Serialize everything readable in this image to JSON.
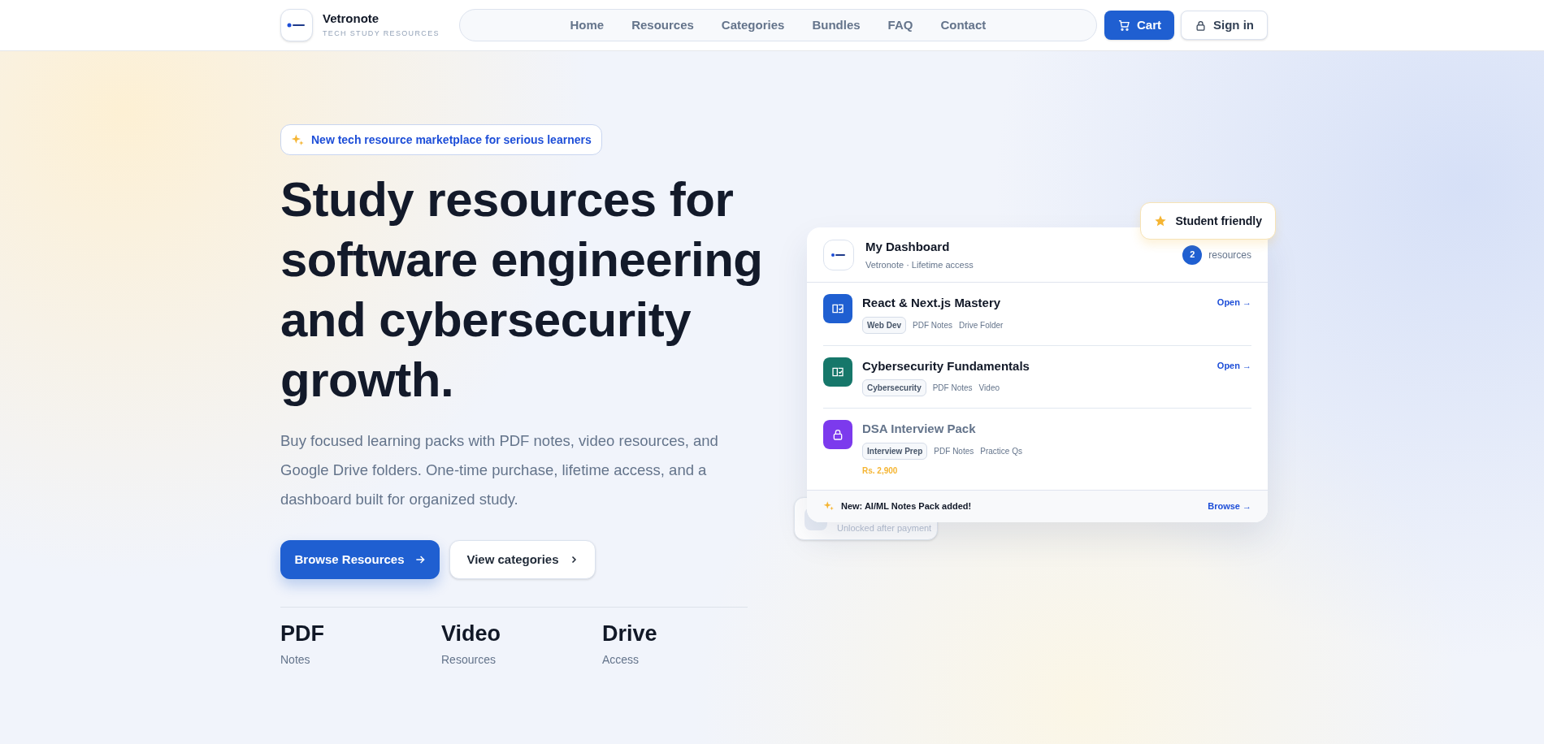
{
  "header": {
    "brand": "Vetronote",
    "tagline": "TECH STUDY RESOURCES",
    "nav": [
      {
        "label": "Home",
        "selected": false
      },
      {
        "label": "Resources",
        "selected": false
      },
      {
        "label": "Categories",
        "selected": false
      },
      {
        "label": "Bundles",
        "selected": false
      },
      {
        "label": "FAQ",
        "selected": false
      },
      {
        "label": "Contact",
        "selected": false
      }
    ],
    "cart": "Cart",
    "sign_in": "Sign in"
  },
  "hero": {
    "badge": "New tech resource marketplace for serious learners",
    "heading": "Study resources for software engineering and cybersecurity growth.",
    "description": "Buy focused learning packs with PDF notes, video resources, and Google Drive folders. One-time purchase, lifetime access, and a dashboard built for organized study.",
    "primary_button": "Browse Resources",
    "secondary_button": "View categories",
    "stats": [
      {
        "value": "PDF",
        "label": "Notes"
      },
      {
        "value": "Video",
        "label": "Resources"
      },
      {
        "value": "Drive",
        "label": "Access"
      }
    ]
  },
  "dashboard": {
    "floating_badge": "Student friendly",
    "hidden_card_text": "Unlocked after payment",
    "title": "My Dashboard",
    "subtitle": "Vetronote · Lifetime access",
    "count": "2",
    "count_label": "resources",
    "items": [
      {
        "kind": "unlocked",
        "color": "#1f5fd1",
        "title": "React & Next.js Mastery",
        "tag": "Web Dev",
        "meta": [
          "PDF Notes",
          "Drive Folder"
        ],
        "action": "Open →"
      },
      {
        "kind": "unlocked",
        "color": "#16776a",
        "title": "Cybersecurity Fundamentals",
        "tag": "Cybersecurity",
        "meta": [
          "PDF Notes",
          "Video"
        ],
        "action": "Open →"
      },
      {
        "kind": "locked",
        "color": "#7c3aed",
        "title": "DSA Interview Pack",
        "tag": "Interview Prep",
        "meta": [
          "PDF Notes",
          "Practice Qs"
        ],
        "price": "Rs. 2,900"
      }
    ],
    "footer_text": "New: AI/ML Notes Pack added!",
    "footer_link": "Browse →"
  }
}
